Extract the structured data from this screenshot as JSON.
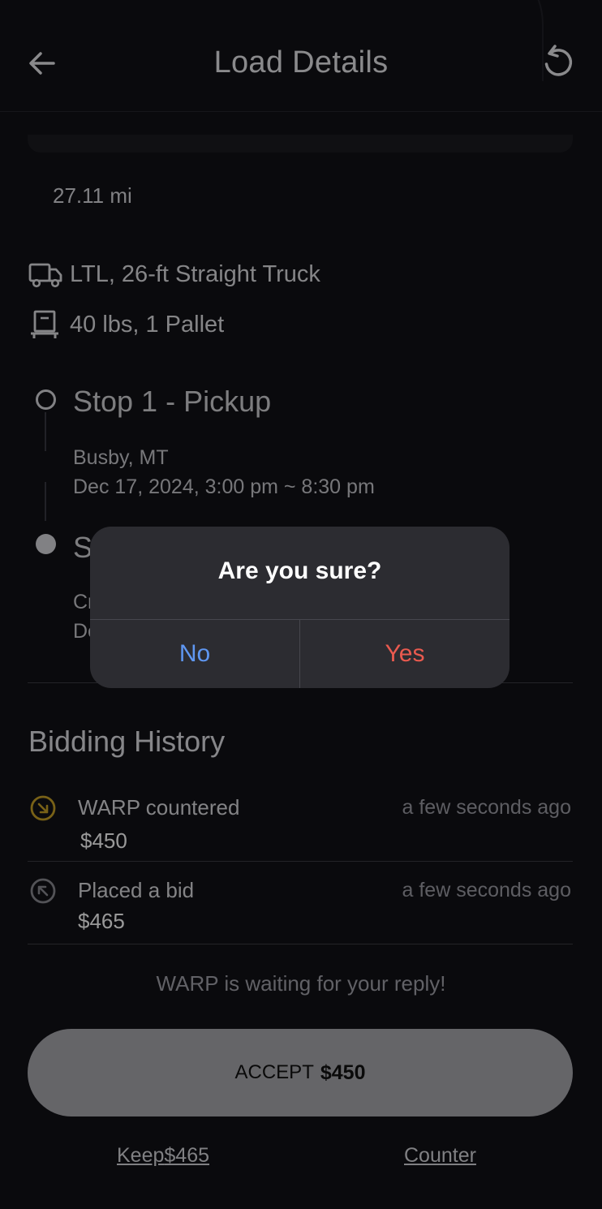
{
  "header": {
    "title": "Load Details",
    "back_icon": "arrow-left-icon",
    "refresh_icon": "refresh-icon"
  },
  "route": {
    "distance": "27.11 mi"
  },
  "specs": {
    "truck": "LTL, 26-ft Straight Truck",
    "truck_icon": "truck-icon",
    "cargo": "40 lbs, 1 Pallet",
    "cargo_icon": "pallet-icon"
  },
  "stops": [
    {
      "title": "Stop 1 - Pickup",
      "location": "Busby, MT",
      "window": "Dec 17, 2024, 3:00 pm ~ 8:30 pm"
    },
    {
      "title_visible": "S",
      "location_visible": "Cr",
      "window_visible": "De"
    }
  ],
  "bidding_history": {
    "title": "Bidding History",
    "entries": [
      {
        "label": "WARP countered",
        "amount": "$450",
        "time": "a few seconds ago",
        "icon": "arrow-down-right-circle-icon",
        "icon_color": "#c9a227"
      },
      {
        "label": "Placed a bid",
        "amount": "$465",
        "time": "a few seconds ago",
        "icon": "arrow-up-left-circle-icon",
        "icon_color": "#8a8a92"
      }
    ],
    "waiting_text": "WARP is waiting for your reply!"
  },
  "actions": {
    "accept_prefix": "ACCEPT",
    "accept_amount": "$450",
    "keep_label": "Keep",
    "keep_amount": "$465",
    "counter_label": "Counter"
  },
  "dialog": {
    "title": "Are you sure?",
    "no_label": "No",
    "yes_label": "Yes",
    "no_color": "#5f97f2",
    "yes_color": "#ea5a4f"
  }
}
